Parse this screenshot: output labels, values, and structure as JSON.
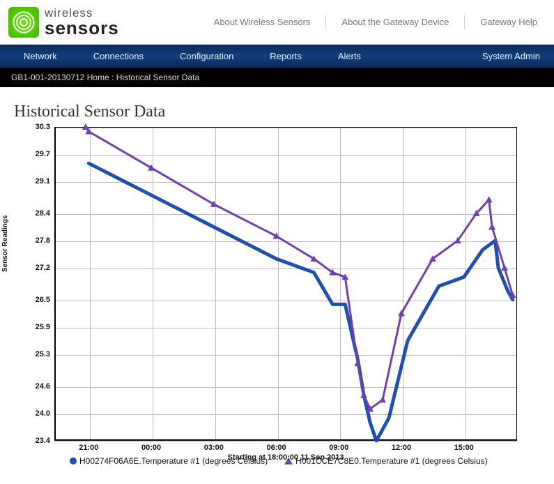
{
  "logo": {
    "line1": "wireless",
    "line2": "sensors"
  },
  "top_links": [
    "About Wireless Sensors",
    "About the Gateway Device",
    "Gateway Help"
  ],
  "nav": {
    "items": [
      "Network",
      "Connections",
      "Configuration",
      "Reports",
      "Alerts"
    ],
    "right": "System Admin"
  },
  "breadcrumb": "GB1-001-20130712 Home : Historical Sensor Data",
  "page_title": "Historical Sensor Data",
  "legend": {
    "s1": "H00274F06A6E.Temperature #1 (degrees Celsius)",
    "s2": "H001CCE7C8E0.Temperature #1 (degrees Celsius)"
  },
  "chart_data": {
    "type": "line",
    "title": "",
    "xlabel": "Starting at 18:00:00  11 Sep 2013",
    "ylabel": "Sensor Readings",
    "x_categories": [
      "21:00",
      "00:00",
      "03:00",
      "06:00",
      "09:00",
      "12:00",
      "15:00"
    ],
    "y_ticks": [
      23.4,
      24.0,
      24.6,
      25.3,
      25.9,
      26.5,
      27.2,
      27.8,
      28.4,
      29.1,
      29.7,
      30.3
    ],
    "ylim": [
      23.4,
      30.3
    ],
    "series": [
      {
        "name": "H00274F06A6E.Temperature #1 (degrees Celsius)",
        "color": "#1e4fb3",
        "marker": "dot",
        "x": [
          0,
          1,
          2,
          3,
          3.6,
          3.9,
          4.1,
          4.3,
          4.4,
          4.5,
          4.6,
          4.8,
          5.1,
          5.6,
          6.0,
          6.3,
          6.5,
          6.55,
          6.7,
          6.78
        ],
        "y": [
          29.5,
          28.8,
          28.1,
          27.4,
          27.1,
          26.4,
          26.4,
          25.2,
          24.4,
          23.8,
          23.4,
          23.9,
          25.6,
          26.8,
          27.0,
          27.6,
          27.8,
          27.2,
          26.7,
          26.5
        ]
      },
      {
        "name": "H001CCE7C8E0.Temperature #1 (degrees Celsius)",
        "color": "#6f3fb3",
        "marker": "triangle",
        "x": [
          -0.05,
          0,
          1,
          2,
          3,
          3.6,
          3.9,
          4.1,
          4.3,
          4.4,
          4.5,
          4.7,
          5.0,
          5.5,
          5.9,
          6.2,
          6.4,
          6.45,
          6.65,
          6.78
        ],
        "y": [
          30.3,
          30.2,
          29.4,
          28.6,
          27.9,
          27.4,
          27.1,
          27.0,
          25.1,
          24.4,
          24.1,
          24.3,
          26.2,
          27.4,
          27.8,
          28.4,
          28.7,
          28.1,
          27.2,
          26.6
        ]
      }
    ]
  }
}
